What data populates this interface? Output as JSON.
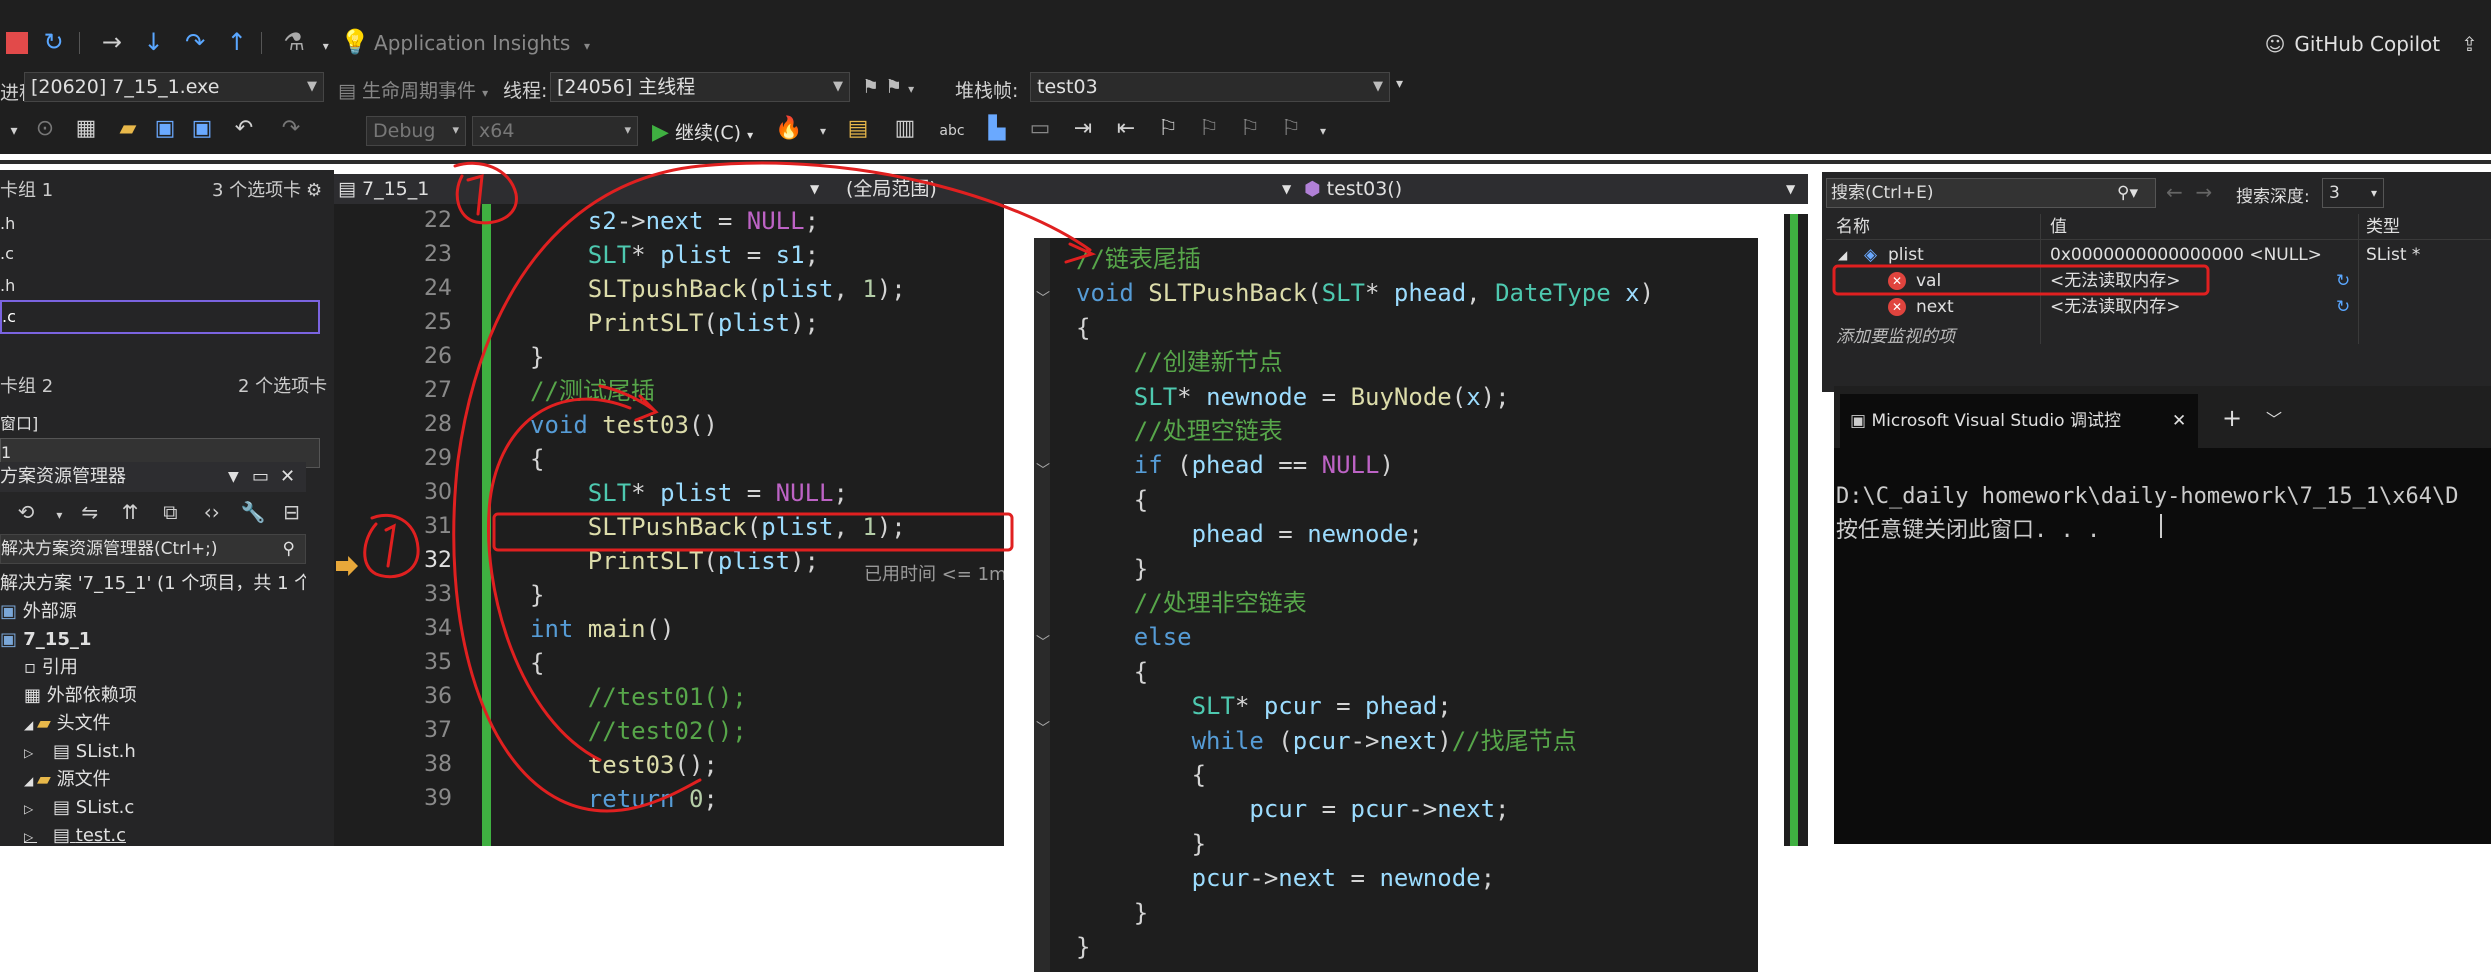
{
  "toolbar1": {
    "app_insights": "Application Insights",
    "copilot": "GitHub Copilot"
  },
  "toolbar2": {
    "process_label": "进程:",
    "process_value": "[20620] 7_15_1.exe",
    "lifecycle_label": "生命周期事件",
    "thread_label": "线程:",
    "thread_value": "[24056] 主线程",
    "stack_label": "堆栈帧:",
    "stack_value": "test03"
  },
  "toolbar3": {
    "config_value": "Debug",
    "platform_value": "x64",
    "continue_label": "继续(C)"
  },
  "left_panel": {
    "group1_label": "卡组 1",
    "group1_count": "3 个选项卡",
    "group1_tabs": [
      ".h",
      ".c",
      ".h",
      ".c"
    ],
    "group2_label": "卡组 2",
    "group2_count": "2 个选项卡",
    "group2_item": "窗口]",
    "group2_field": "1"
  },
  "solution_explorer": {
    "title": "方案资源管理器",
    "search_placeholder": "解决方案资源管理器(Ctrl+;)",
    "items": [
      {
        "text": "解决方案 '7_15_1' (1 个项目，共 1 个",
        "indent": 0
      },
      {
        "text": "外部源",
        "indent": 0
      },
      {
        "text": "7_15_1",
        "indent": 0
      },
      {
        "text": "引用",
        "indent": 1
      },
      {
        "text": "外部依赖项",
        "indent": 1
      },
      {
        "text": "头文件",
        "indent": 1
      },
      {
        "text": "SList.h",
        "indent": 2
      },
      {
        "text": "源文件",
        "indent": 1
      },
      {
        "text": "SList.c",
        "indent": 2
      },
      {
        "text": "test.c",
        "indent": 2
      }
    ]
  },
  "editor": {
    "file_tab": "7_15_1",
    "scope": "(全局范围)",
    "function": "test03()",
    "elapsed": "已用时间 <= 1m",
    "line_numbers": [
      "22",
      "23",
      "24",
      "25",
      "26",
      "27",
      "28",
      "29",
      "30",
      "31",
      "32",
      "33",
      "34",
      "35",
      "36",
      "37",
      "38",
      "39"
    ],
    "lines": [
      [
        [
          "pa",
          "    s2"
        ],
        [
          "pl",
          "->"
        ],
        [
          "pa",
          "next"
        ],
        [
          "pl",
          " = "
        ],
        [
          "ma",
          "NULL"
        ],
        [
          "pl",
          ";"
        ]
      ],
      [
        [
          "ty",
          "    SLT"
        ],
        [
          "pl",
          "* "
        ],
        [
          "pa",
          "plist"
        ],
        [
          "pl",
          " = "
        ],
        [
          "pa",
          "s1"
        ],
        [
          "pl",
          ";"
        ]
      ],
      [
        [
          "fn",
          "    SLTpushBack"
        ],
        [
          "pl",
          "("
        ],
        [
          "pa",
          "plist"
        ],
        [
          "pl",
          ", "
        ],
        [
          "nu",
          "1"
        ],
        [
          "pl",
          ");"
        ]
      ],
      [
        [
          "fn",
          "    PrintSLT"
        ],
        [
          "pl",
          "("
        ],
        [
          "pa",
          "plist"
        ],
        [
          "pl",
          ");"
        ]
      ],
      [
        [
          "pl",
          "}"
        ]
      ],
      [
        [
          "cm",
          "//测试尾插"
        ]
      ],
      [
        [
          "kw",
          "void "
        ],
        [
          "fn",
          "test03"
        ],
        [
          "pl",
          "()"
        ]
      ],
      [
        [
          "pl",
          "{"
        ]
      ],
      [
        [
          "ty",
          "    SLT"
        ],
        [
          "pl",
          "* "
        ],
        [
          "pa",
          "plist"
        ],
        [
          "pl",
          " = "
        ],
        [
          "ma",
          "NULL"
        ],
        [
          "pl",
          ";"
        ]
      ],
      [
        [
          "fn",
          "    SLTPushBack"
        ],
        [
          "pl",
          "("
        ],
        [
          "pa",
          "plist"
        ],
        [
          "pl",
          ", "
        ],
        [
          "nu",
          "1"
        ],
        [
          "pl",
          ");"
        ]
      ],
      [
        [
          "fn",
          "    PrintSLT"
        ],
        [
          "pl",
          "("
        ],
        [
          "pa",
          "plist"
        ],
        [
          "pl",
          ");"
        ]
      ],
      [
        [
          "pl",
          "}"
        ]
      ],
      [
        [
          "kw",
          "int "
        ],
        [
          "fn",
          "main"
        ],
        [
          "pl",
          "()"
        ]
      ],
      [
        [
          "pl",
          "{"
        ]
      ],
      [
        [
          "cm",
          "    //test01();"
        ]
      ],
      [
        [
          "cm",
          "    //test02();"
        ]
      ],
      [
        [
          "fn",
          "    test03"
        ],
        [
          "pl",
          "();"
        ]
      ],
      [
        [
          "kw",
          "    return "
        ],
        [
          "nu",
          "0"
        ],
        [
          "pl",
          ";"
        ]
      ]
    ]
  },
  "code_popup": {
    "lines": [
      [
        [
          "cm",
          "//链表尾插"
        ]
      ],
      [
        [
          "kw",
          "void "
        ],
        [
          "fn",
          "SLTPushBack"
        ],
        [
          "pl",
          "("
        ],
        [
          "ty",
          "SLT"
        ],
        [
          "pl",
          "* "
        ],
        [
          "pa",
          "phead"
        ],
        [
          "pl",
          ", "
        ],
        [
          "ty",
          "DateType"
        ],
        [
          "pl",
          " "
        ],
        [
          "pa",
          "x"
        ],
        [
          "pl",
          ")"
        ]
      ],
      [
        [
          "pl",
          "{"
        ]
      ],
      [
        [
          "cm",
          "    //创建新节点"
        ]
      ],
      [
        [
          "ty",
          "    SLT"
        ],
        [
          "pl",
          "* "
        ],
        [
          "pa",
          "newnode"
        ],
        [
          "pl",
          " = "
        ],
        [
          "fn",
          "BuyNode"
        ],
        [
          "pl",
          "("
        ],
        [
          "pa",
          "x"
        ],
        [
          "pl",
          ");"
        ]
      ],
      [
        [
          "cm",
          "    //处理空链表"
        ]
      ],
      [
        [
          "kw",
          "    if "
        ],
        [
          "pl",
          "("
        ],
        [
          "pa",
          "phead"
        ],
        [
          "pl",
          " == "
        ],
        [
          "ma",
          "NULL"
        ],
        [
          "pl",
          ")"
        ]
      ],
      [
        [
          "pl",
          "    {"
        ]
      ],
      [
        [
          "pa",
          "        phead"
        ],
        [
          "pl",
          " = "
        ],
        [
          "pa",
          "newnode"
        ],
        [
          "pl",
          ";"
        ]
      ],
      [
        [
          "pl",
          "    }"
        ]
      ],
      [
        [
          "cm",
          "    //处理非空链表"
        ]
      ],
      [
        [
          "kw",
          "    else"
        ]
      ],
      [
        [
          "pl",
          "    {"
        ]
      ],
      [
        [
          "ty",
          "        SLT"
        ],
        [
          "pl",
          "* "
        ],
        [
          "pa",
          "pcur"
        ],
        [
          "pl",
          " = "
        ],
        [
          "pa",
          "phead"
        ],
        [
          "pl",
          ";"
        ]
      ],
      [
        [
          "kw",
          "        while "
        ],
        [
          "pl",
          "("
        ],
        [
          "pa",
          "pcur"
        ],
        [
          "pl",
          "->"
        ],
        [
          "pa",
          "next"
        ],
        [
          "pl",
          ")"
        ],
        [
          "cm",
          "//找尾节点"
        ]
      ],
      [
        [
          "pl",
          "        {"
        ]
      ],
      [
        [
          "pa",
          "            pcur"
        ],
        [
          "pl",
          " = "
        ],
        [
          "pa",
          "pcur"
        ],
        [
          "pl",
          "->"
        ],
        [
          "pa",
          "next"
        ],
        [
          "pl",
          ";"
        ]
      ],
      [
        [
          "pl",
          "        }"
        ]
      ],
      [
        [
          "pa",
          "        pcur"
        ],
        [
          "pl",
          "->"
        ],
        [
          "pa",
          "next"
        ],
        [
          "pl",
          " = "
        ],
        [
          "pa",
          "newnode"
        ],
        [
          "pl",
          ";"
        ]
      ],
      [
        [
          "pl",
          "    }"
        ]
      ],
      [
        [
          "pl",
          "}"
        ]
      ]
    ]
  },
  "watch": {
    "search_placeholder": "搜索(Ctrl+E)",
    "depth_label": "搜索深度:",
    "depth_value": "3",
    "col_name": "名称",
    "col_value": "值",
    "col_type": "类型",
    "rows": [
      {
        "name": "plist",
        "value": "0x0000000000000000 <NULL>",
        "type": "SList *"
      },
      {
        "name": "val",
        "value": "<无法读取内存>",
        "type": ""
      },
      {
        "name": "next",
        "value": "<无法读取内存>",
        "type": ""
      }
    ],
    "add_item": "添加要监视的项"
  },
  "console": {
    "tab_title": "Microsoft Visual Studio 调试控",
    "line1": "D:\\C_daily homework\\daily-homework\\7_15_1\\x64\\D",
    "line2": "按任意键关闭此窗口. . ."
  },
  "colors": {
    "ide_bg": "#1f1f1f",
    "editor_bg": "#1e1e1e",
    "accent_green": "#3fb041",
    "annotation_red": "#e02020"
  }
}
